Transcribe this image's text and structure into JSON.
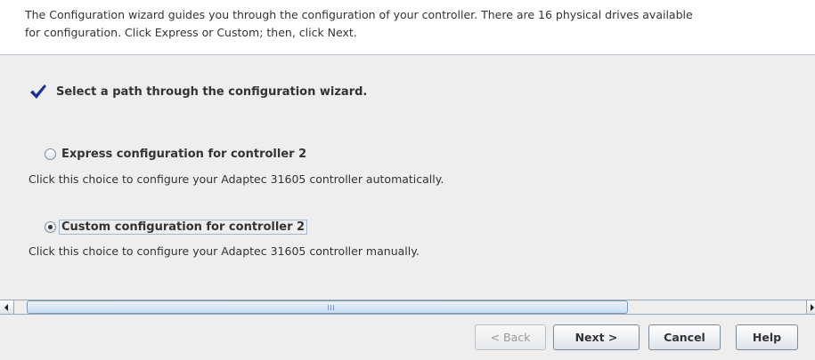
{
  "intro": {
    "line1": "The Configuration wizard guides you through the configuration of your controller. There are 16 physical drives available",
    "line2": "for configuration. Click Express or Custom; then, click Next."
  },
  "step": {
    "icon": "checkmark-icon",
    "title": "Select a path through the configuration wizard."
  },
  "options": [
    {
      "label": "Express configuration for controller 2",
      "description": "Click this choice to configure your Adaptec 31605 controller automatically.",
      "selected": false
    },
    {
      "label": "Custom configuration for controller 2",
      "description": "Click this choice to configure your Adaptec 31605 controller manually.",
      "selected": true
    }
  ],
  "buttons": {
    "back": "< Back",
    "next": "Next >",
    "cancel": "Cancel",
    "help": "Help"
  },
  "colors": {
    "checkmark": "#1a2f9e",
    "scroll_thumb": "#c8dcf2"
  }
}
